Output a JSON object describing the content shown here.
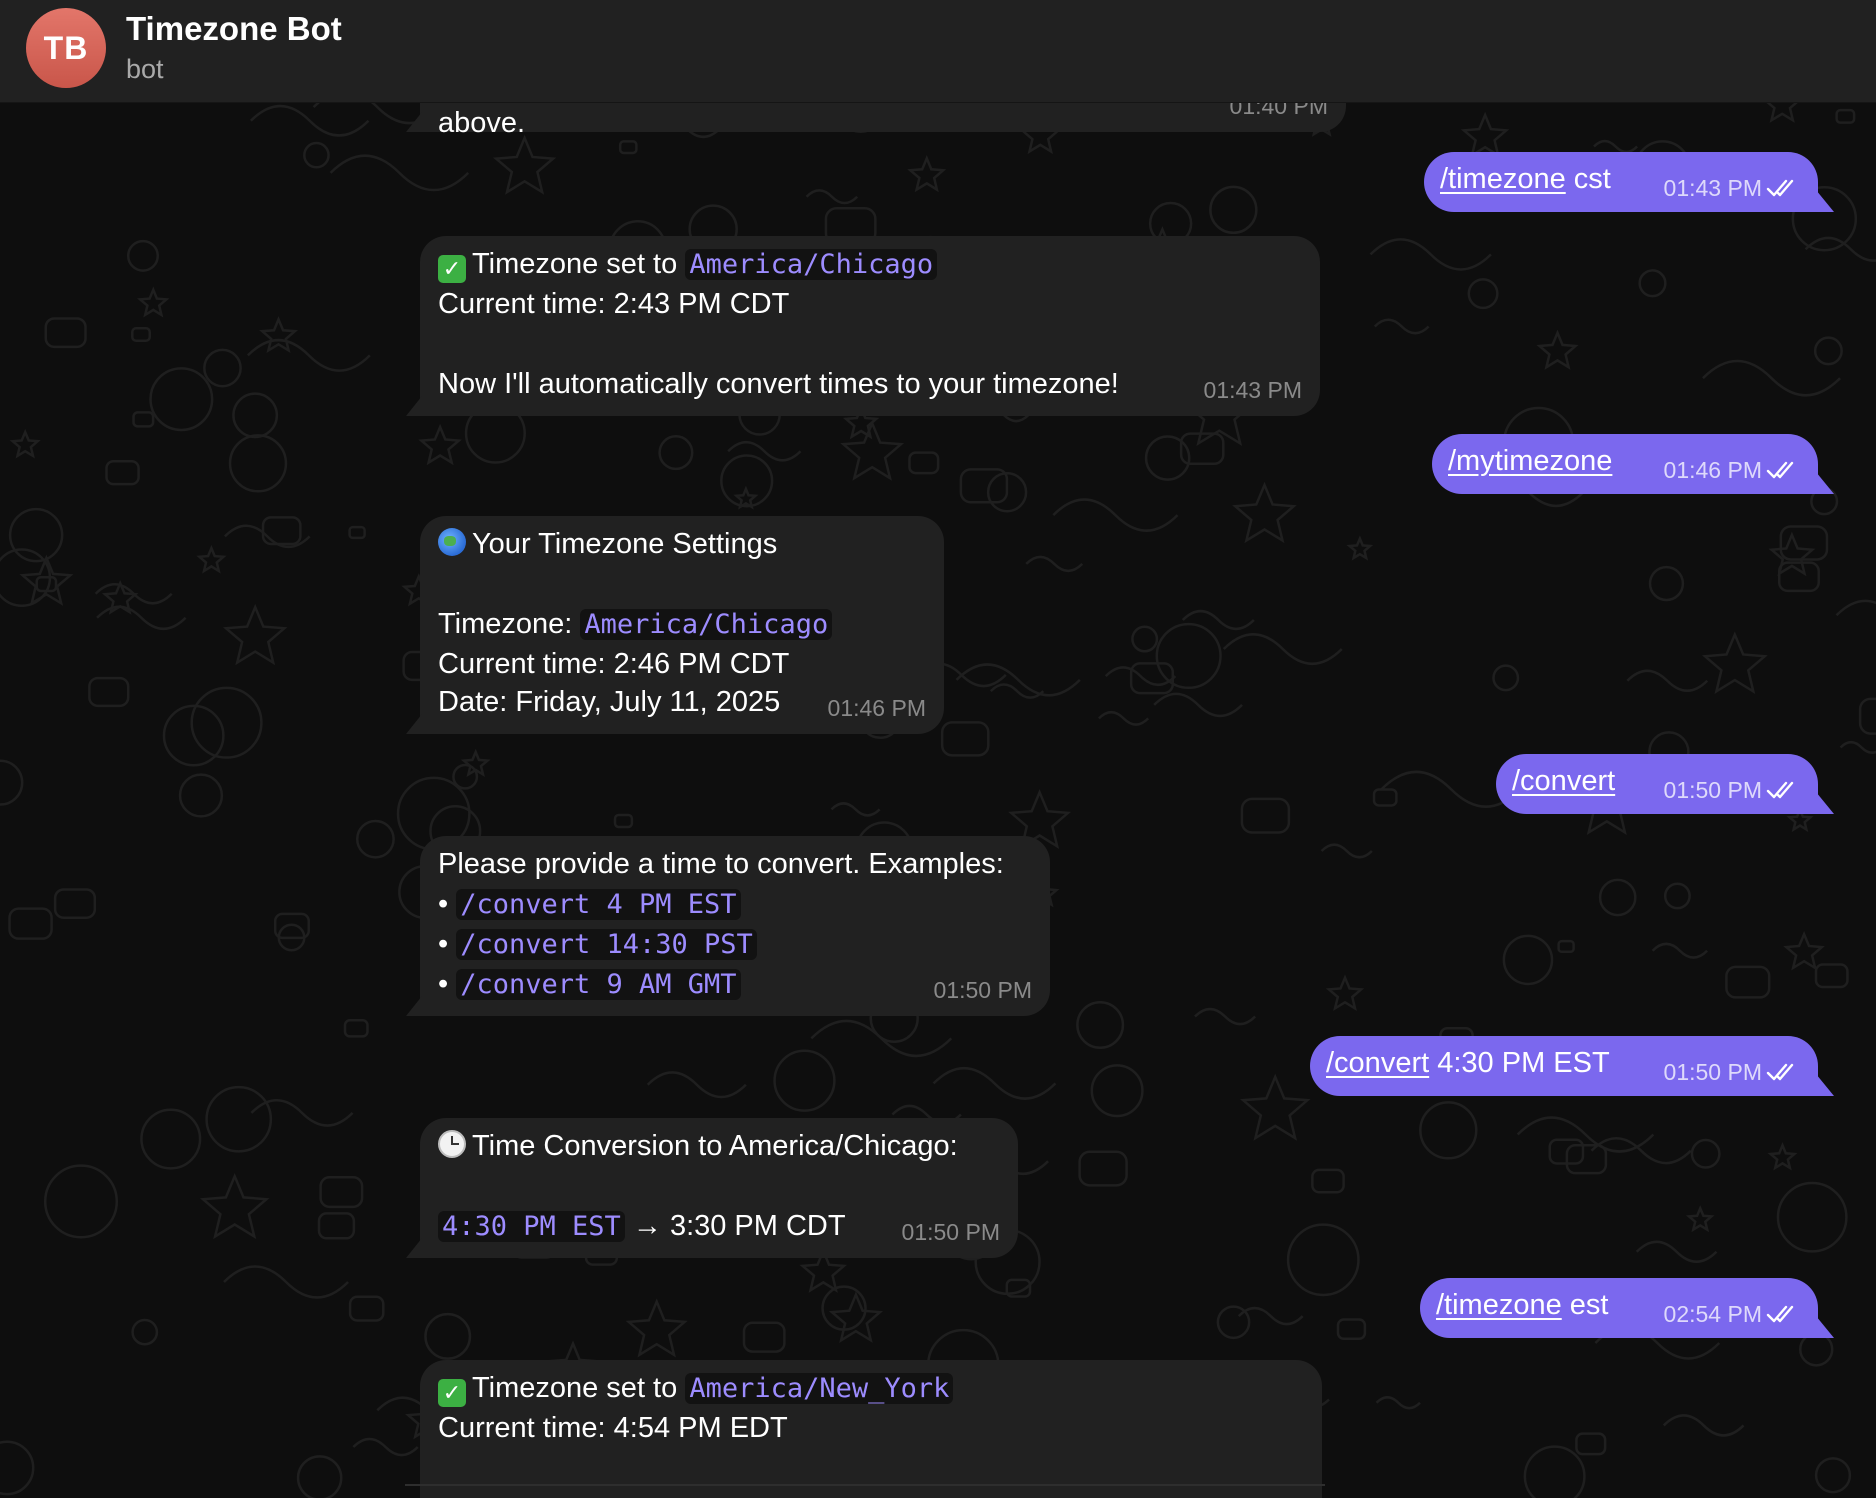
{
  "header": {
    "avatar_initials": "TB",
    "title": "Timezone Bot",
    "status": "bot",
    "avatar_color": "#d8655a"
  },
  "colors": {
    "outgoing_bubble": "#7b68ee",
    "incoming_bubble": "#212121",
    "code_text": "#9d8cff"
  },
  "messages": {
    "m0": {
      "text_fragment": "above.",
      "time": "01:40 PM"
    },
    "m1": {
      "command": "/timezone",
      "arg": " cst",
      "time": "01:43 PM"
    },
    "m2": {
      "line1_prefix": "Timezone set to",
      "line1_code": "America/Chicago",
      "line2": "Current time: 2:43 PM CDT",
      "line4": "Now I'll automatically convert times to your timezone!",
      "time": "01:43 PM"
    },
    "m3": {
      "command": "/mytimezone",
      "time": "01:46 PM"
    },
    "m4": {
      "heading": "Your Timezone Settings",
      "tz_label": "Timezone:",
      "tz_code": "America/Chicago",
      "current": "Current time: 2:46 PM CDT",
      "date": "Date: Friday, July 11, 2025",
      "time": "01:46 PM"
    },
    "m5": {
      "command": "/convert",
      "time": "01:50 PM"
    },
    "m6": {
      "intro": "Please provide a time to convert. Examples:",
      "bullet": "•",
      "examples": [
        "/convert 4 PM EST",
        "/convert 14:30 PST",
        "/convert 9 AM GMT"
      ],
      "time": "01:50 PM"
    },
    "m7": {
      "command": "/convert",
      "arg": " 4:30 PM EST",
      "time": "01:50 PM"
    },
    "m8": {
      "heading": "Time Conversion to America/Chicago:",
      "from_code": "4:30 PM EST",
      "arrow": "→",
      "to": "3:30 PM CDT",
      "time": "01:50 PM"
    },
    "m9": {
      "command": "/timezone",
      "arg": " est",
      "time": "02:54 PM"
    },
    "m10": {
      "line1_prefix": "Timezone set to",
      "line1_code": "America/New_York",
      "line2": "Current time: 4:54 PM EDT"
    }
  }
}
